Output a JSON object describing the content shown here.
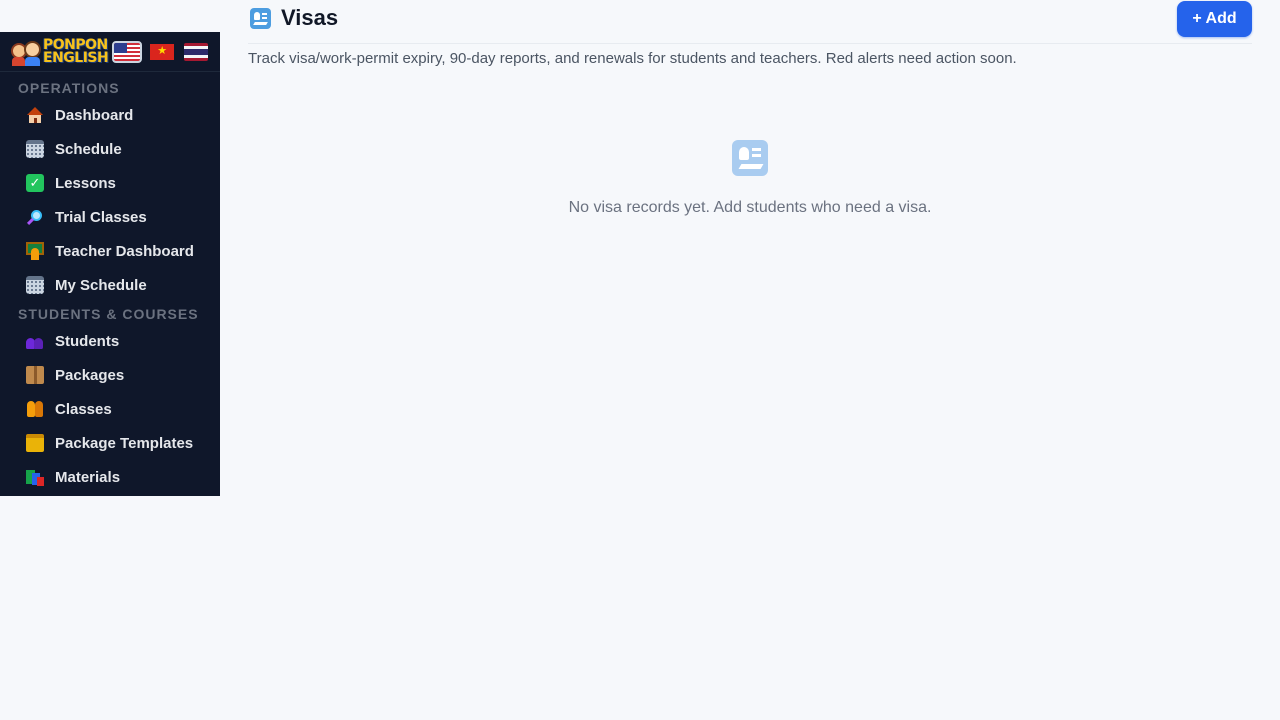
{
  "brand": {
    "logo_line1": "PONPON",
    "logo_line2": "ENGLISH"
  },
  "languages": [
    {
      "code": "en",
      "icon": "us-flag-icon"
    },
    {
      "code": "vi",
      "icon": "vietnam-flag-icon"
    },
    {
      "code": "th",
      "icon": "thailand-flag-icon"
    }
  ],
  "sidebar": {
    "sections": [
      {
        "title": "OPERATIONS",
        "items": [
          {
            "label": "Dashboard",
            "icon": "house-icon"
          },
          {
            "label": "Schedule",
            "icon": "calendar-icon"
          },
          {
            "label": "Lessons",
            "icon": "checkmark-icon"
          },
          {
            "label": "Trial Classes",
            "icon": "magnifier-icon"
          },
          {
            "label": "Teacher Dashboard",
            "icon": "teacher-icon"
          },
          {
            "label": "My Schedule",
            "icon": "calendar-icon"
          }
        ]
      },
      {
        "title": "STUDENTS & COURSES",
        "items": [
          {
            "label": "Students",
            "icon": "people-icon"
          },
          {
            "label": "Packages",
            "icon": "package-icon"
          },
          {
            "label": "Classes",
            "icon": "children-icon"
          },
          {
            "label": "Package Templates",
            "icon": "folder-icon"
          },
          {
            "label": "Materials",
            "icon": "books-icon"
          }
        ]
      }
    ]
  },
  "page": {
    "title": "Visas",
    "title_icon": "passport-control-icon",
    "add_button_label": "+ Add",
    "subtitle": "Track visa/work-permit expiry, 90-day reports, and renewals for students and teachers. Red alerts need action soon.",
    "empty_state": {
      "icon": "passport-control-icon",
      "message": "No visa records yet. Add students who need a visa."
    }
  },
  "colors": {
    "sidebar_bg": "#0f172a",
    "page_bg": "#f6f8fb",
    "accent": "#2563eb",
    "logo_yellow": "#f7c21b"
  }
}
